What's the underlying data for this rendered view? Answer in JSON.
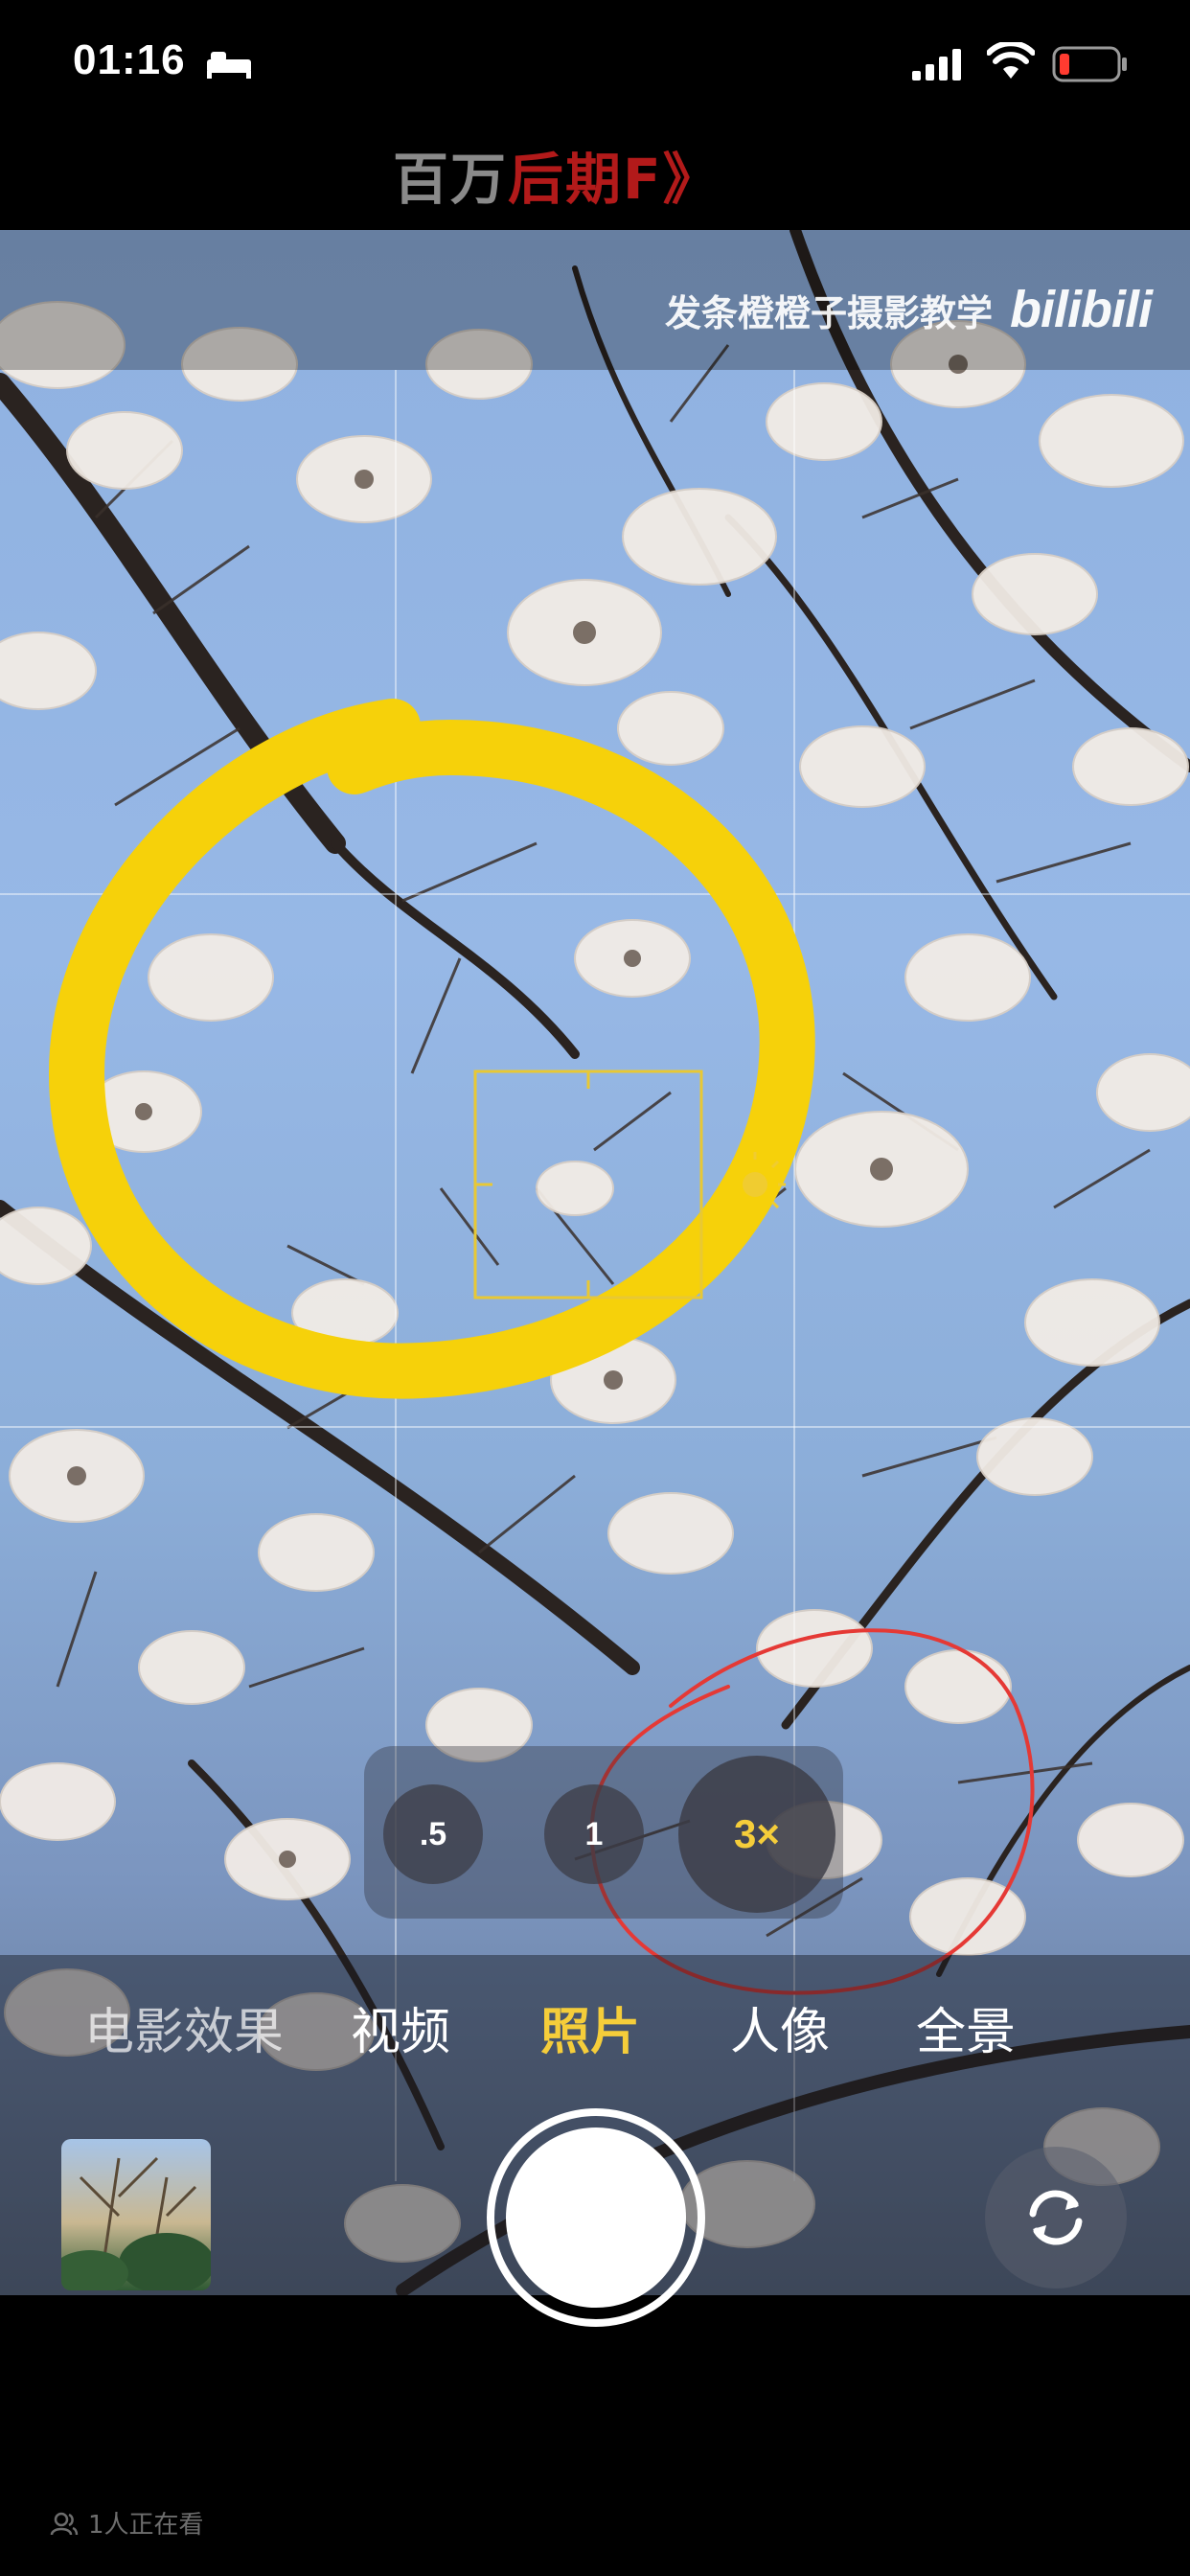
{
  "status": {
    "time": "01:16",
    "icons": [
      "bed-icon",
      "cellular-signal-icon",
      "wifi-icon",
      "battery-low-icon"
    ]
  },
  "video_title": {
    "part1": "百万",
    "part2": "后期",
    "part3": "F》"
  },
  "watermark": {
    "text": "发条橙橙子摄影教学",
    "logo": "bilibili"
  },
  "camera": {
    "zoom_options": [
      ".5",
      "1",
      "3×"
    ],
    "selected_zoom": "3×",
    "modes": [
      "电影效果",
      "视频",
      "照片",
      "人像",
      "全景"
    ],
    "active_mode": "照片",
    "icons": [
      "shutter-button",
      "switch-camera-icon",
      "last-photo-thumbnail"
    ]
  },
  "annotations": {
    "yellow_circle_color": "#f6d10a",
    "red_circle_color": "#e53935",
    "focus_box_color": "#e8c834"
  },
  "footer": {
    "viewers": "1人正在看"
  }
}
